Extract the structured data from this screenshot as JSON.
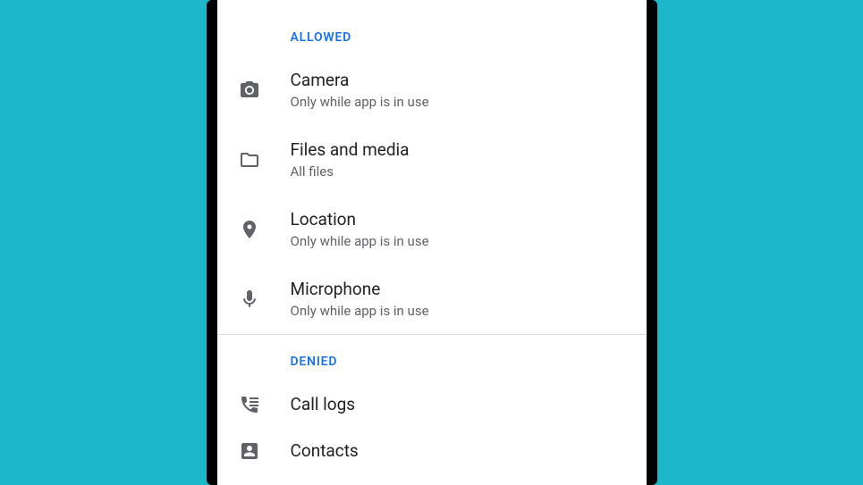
{
  "sections": {
    "allowed": {
      "header": "ALLOWED",
      "items": [
        {
          "title": "Camera",
          "sub": "Only while app is in use",
          "icon": "camera"
        },
        {
          "title": "Files and media",
          "sub": "All files",
          "icon": "folder"
        },
        {
          "title": "Location",
          "sub": "Only while app is in use",
          "icon": "location"
        },
        {
          "title": "Microphone",
          "sub": "Only while app is in use",
          "icon": "mic"
        }
      ]
    },
    "denied": {
      "header": "DENIED",
      "items": [
        {
          "title": "Call logs",
          "sub": "",
          "icon": "calllog"
        },
        {
          "title": "Contacts",
          "sub": "",
          "icon": "contacts"
        }
      ]
    }
  }
}
